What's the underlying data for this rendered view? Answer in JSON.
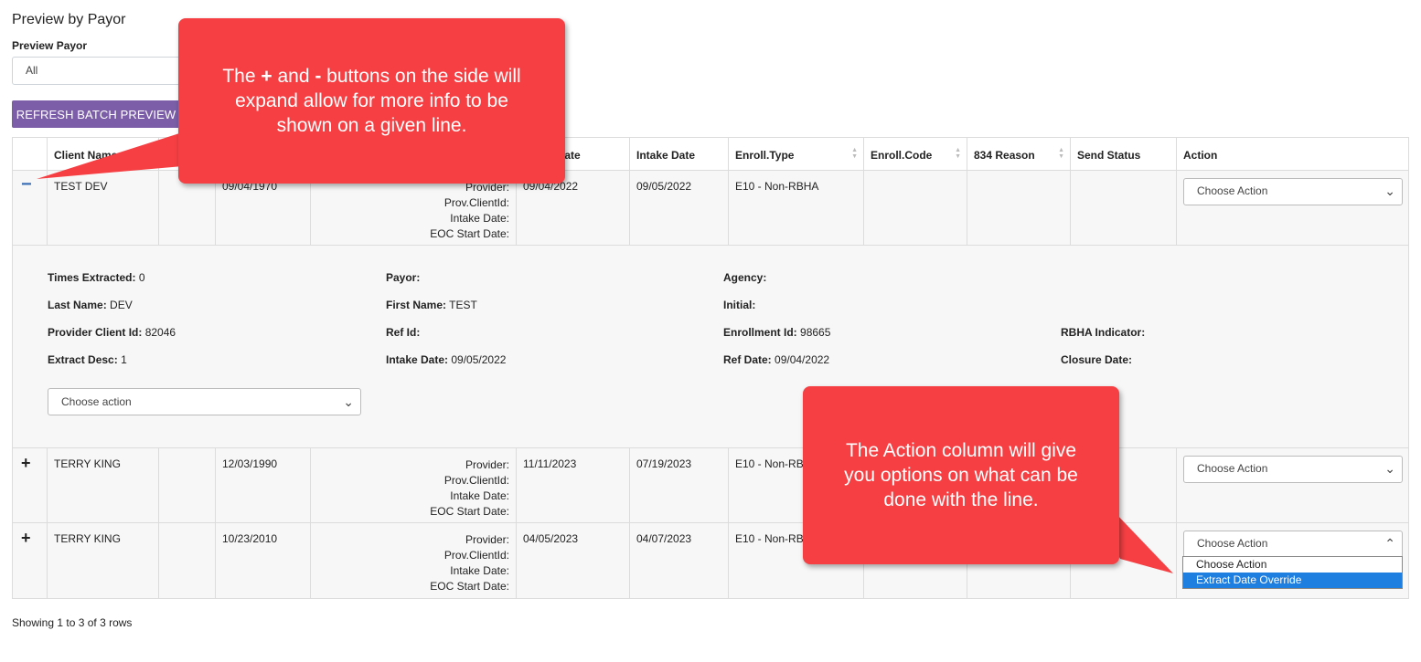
{
  "page": {
    "title": "Preview by Payor",
    "payor_label": "Preview Payor",
    "payor_value": "All",
    "refresh_label": "REFRESH BATCH PREVIEW"
  },
  "table": {
    "headers": [
      "Client Name",
      "",
      "",
      "",
      "l Date",
      "Intake Date",
      "Enroll.Type",
      "Enroll.Code",
      "834 Reason",
      "Send Status",
      "Action"
    ],
    "prov_labels": [
      "Provider:",
      "Prov.ClientId:",
      "Intake Date:",
      "EOC Start Date:"
    ],
    "rows": [
      {
        "toggle": "−",
        "name": "TEST DEV",
        "dob": "09/04/1970",
        "ref_date": "09/04/2022",
        "intake": "09/05/2022",
        "type": "E10 - Non-RBHA",
        "action": "Choose Action"
      },
      {
        "toggle": "+",
        "name": "TERRY KING",
        "dob": "12/03/1990",
        "ref_date": "11/11/2023",
        "intake": "07/19/2023",
        "type": "E10 - Non-RBH",
        "action": "Choose Action"
      },
      {
        "toggle": "+",
        "name": "TERRY KING",
        "dob": "10/23/2010",
        "ref_date": "04/05/2023",
        "intake": "04/07/2023",
        "type": "E10 - Non-RBH",
        "action": "Choose Action"
      }
    ]
  },
  "detail": {
    "times_extracted_label": "Times Extracted:",
    "times_extracted": "0",
    "payor_label": "Payor:",
    "agency_label": "Agency:",
    "last_name_label": "Last Name:",
    "last_name": "DEV",
    "first_name_label": "First Name:",
    "first_name": "TEST",
    "initial_label": "Initial:",
    "provider_client_id_label": "Provider Client Id:",
    "provider_client_id": "82046",
    "ref_id_label": "Ref Id:",
    "enrollment_id_label": "Enrollment Id:",
    "enrollment_id": "98665",
    "rbha_label": "RBHA Indicator:",
    "extract_desc_label": "Extract Desc:",
    "extract_desc": "1",
    "intake_date_label": "Intake Date:",
    "intake_date": "09/05/2022",
    "ref_date_label": "Ref Date:",
    "ref_date": "09/04/2022",
    "closure_date_label": "Closure Date:",
    "action_placeholder": "Choose action"
  },
  "dropdown": {
    "options": [
      "Choose Action",
      "Extract Date Override"
    ]
  },
  "footer": {
    "text": "Showing 1 to 3 of 3 rows"
  },
  "callouts": {
    "top_line1_a": "The ",
    "top_line1_plus": "+",
    "top_line1_b": " and ",
    "top_line1_minus": "-",
    "top_line1_c": " buttons on the",
    "top_rest": "side will expand allow for more info to be shown on a given line.",
    "bottom": "The Action column will give you options on what can be done with the line."
  },
  "colors": {
    "accent": "#7b5ea7",
    "callout": "#f53f43",
    "selected": "#1e7fe0"
  }
}
